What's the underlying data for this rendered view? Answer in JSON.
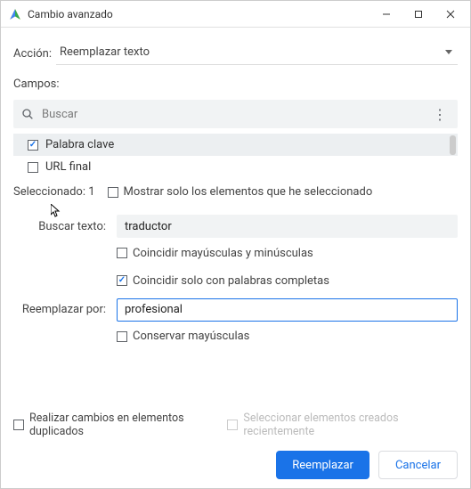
{
  "window": {
    "title": "Cambio avanzado"
  },
  "action": {
    "label": "Acción:",
    "value": "Reemplazar texto"
  },
  "campos": {
    "label": "Campos:"
  },
  "search": {
    "placeholder": "Buscar"
  },
  "list": {
    "items": [
      {
        "label": "Palabra clave",
        "checked": true
      },
      {
        "label": "URL final",
        "checked": false
      }
    ]
  },
  "selection": {
    "count_label": "Seleccionado: 1",
    "show_only": "Mostrar solo los elementos que he seleccionado"
  },
  "find": {
    "label": "Buscar texto:",
    "value": "traductor",
    "match_case": "Coincidir mayúsculas y minúsculas",
    "whole_word": "Coincidir solo con palabras completas"
  },
  "replace": {
    "label": "Reemplazar por:",
    "value": "profesional",
    "preserve_case": "Conservar mayúsculas"
  },
  "bottom": {
    "dup": "Realizar cambios en elementos duplicados",
    "recent": "Seleccionar elementos creados recientemente"
  },
  "buttons": {
    "primary": "Reemplazar",
    "secondary": "Cancelar"
  }
}
